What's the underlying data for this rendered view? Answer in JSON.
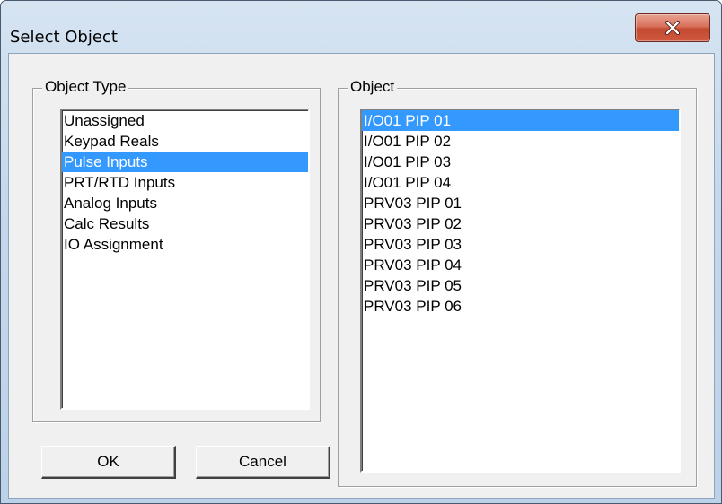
{
  "window": {
    "title": "Select Object"
  },
  "object_type": {
    "legend": "Object Type",
    "items": [
      {
        "label": "Unassigned",
        "selected": false
      },
      {
        "label": "Keypad Reals",
        "selected": false
      },
      {
        "label": "Pulse Inputs",
        "selected": true
      },
      {
        "label": "PRT/RTD Inputs",
        "selected": false
      },
      {
        "label": "Analog Inputs",
        "selected": false
      },
      {
        "label": "Calc Results",
        "selected": false
      },
      {
        "label": "IO Assignment",
        "selected": false
      }
    ]
  },
  "object": {
    "legend": "Object",
    "items": [
      {
        "label": "I/O01 PIP 01",
        "selected": true
      },
      {
        "label": "I/O01 PIP 02",
        "selected": false
      },
      {
        "label": "I/O01 PIP 03",
        "selected": false
      },
      {
        "label": "I/O01 PIP 04",
        "selected": false
      },
      {
        "label": "PRV03 PIP 01",
        "selected": false
      },
      {
        "label": "PRV03 PIP 02",
        "selected": false
      },
      {
        "label": "PRV03 PIP 03",
        "selected": false
      },
      {
        "label": "PRV03 PIP 04",
        "selected": false
      },
      {
        "label": "PRV03 PIP 05",
        "selected": false
      },
      {
        "label": "PRV03 PIP 06",
        "selected": false
      }
    ]
  },
  "buttons": {
    "ok": "OK",
    "cancel": "Cancel"
  },
  "colors": {
    "selection": "#3399ff",
    "close_button": "#c24930"
  },
  "icons": {
    "close": "close-icon"
  }
}
